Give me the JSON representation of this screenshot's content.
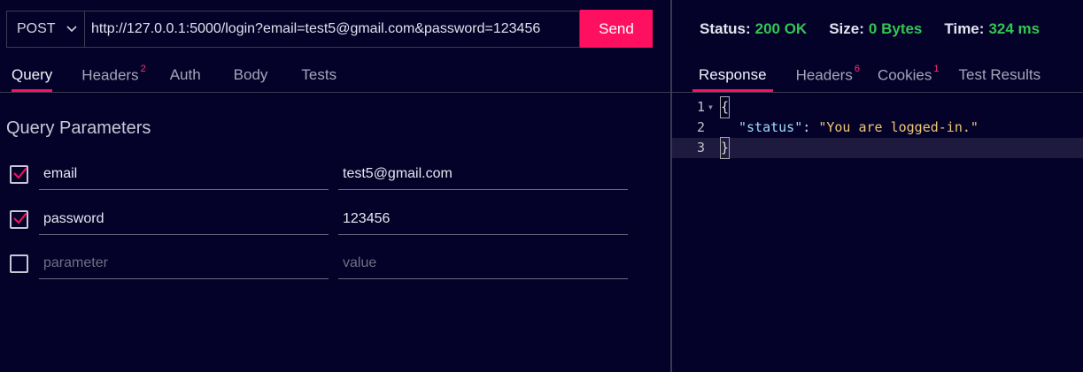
{
  "request": {
    "method": "POST",
    "url": "http://127.0.0.1:5000/login?email=test5@gmail.com&password=123456",
    "send_label": "Send"
  },
  "request_tabs": [
    {
      "label": "Query",
      "badge": "",
      "active": true
    },
    {
      "label": "Headers",
      "badge": "2",
      "active": false
    },
    {
      "label": "Auth",
      "badge": "",
      "active": false
    },
    {
      "label": "Body",
      "badge": "",
      "active": false
    },
    {
      "label": "Tests",
      "badge": "",
      "active": false
    }
  ],
  "query": {
    "title": "Query Parameters",
    "params": [
      {
        "checked": true,
        "name": "email",
        "value": "test5@gmail.com"
      },
      {
        "checked": true,
        "name": "password",
        "value": "123456"
      }
    ],
    "new_param": {
      "checked": false,
      "name_placeholder": "parameter",
      "value_placeholder": "value"
    }
  },
  "response_status": {
    "status_label": "Status:",
    "status_value": "200 OK",
    "size_label": "Size:",
    "size_value": "0 Bytes",
    "time_label": "Time:",
    "time_value": "324 ms"
  },
  "response_tabs": [
    {
      "label": "Response",
      "badge": "",
      "active": true
    },
    {
      "label": "Headers",
      "badge": "6",
      "active": false
    },
    {
      "label": "Cookies",
      "badge": "1",
      "active": false
    },
    {
      "label": "Test Results",
      "badge": "",
      "active": false
    }
  ],
  "response_body": {
    "lines": [
      {
        "n": "1",
        "open": "{"
      },
      {
        "n": "2",
        "key": "\"status\"",
        "sep": ": ",
        "val": "\"You are logged-in.\""
      },
      {
        "n": "3",
        "close": "}"
      }
    ]
  },
  "colors": {
    "accent": "#ff0f5f",
    "success": "#33c553",
    "background": "#05022a"
  }
}
